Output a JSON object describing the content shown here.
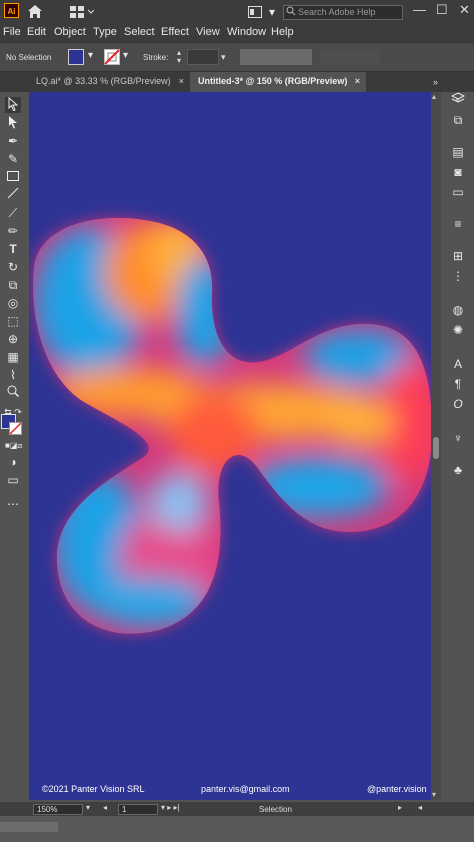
{
  "app": {
    "logo": "Ai",
    "search_placeholder": "Search Adobe Help",
    "win_min": "—",
    "win_max": "☐",
    "win_close": "✕"
  },
  "menu": [
    "File",
    "Edit",
    "Object",
    "Type",
    "Select",
    "Effect",
    "View",
    "Window",
    "Help"
  ],
  "control": {
    "selection_label": "No Selection",
    "stroke_label": "Stroke:",
    "fill_color": "#2e3494",
    "stroke_state": "none"
  },
  "tabs": [
    {
      "label": "LQ.ai* @ 33.33 % (RGB/Preview)",
      "close": "×",
      "active": false
    },
    {
      "label": "Untitled-3* @ 150 % (RGB/Preview)",
      "close": "×",
      "active": true
    }
  ],
  "artboard": {
    "background": "#2e3494",
    "credits": {
      "left": "©2021 Panter Vision SRL",
      "center": "panter.vis@gmail.com",
      "right": "@panter.vision"
    }
  },
  "status": {
    "zoom": "150%",
    "artboard_number": "1",
    "tool": "Selection"
  }
}
